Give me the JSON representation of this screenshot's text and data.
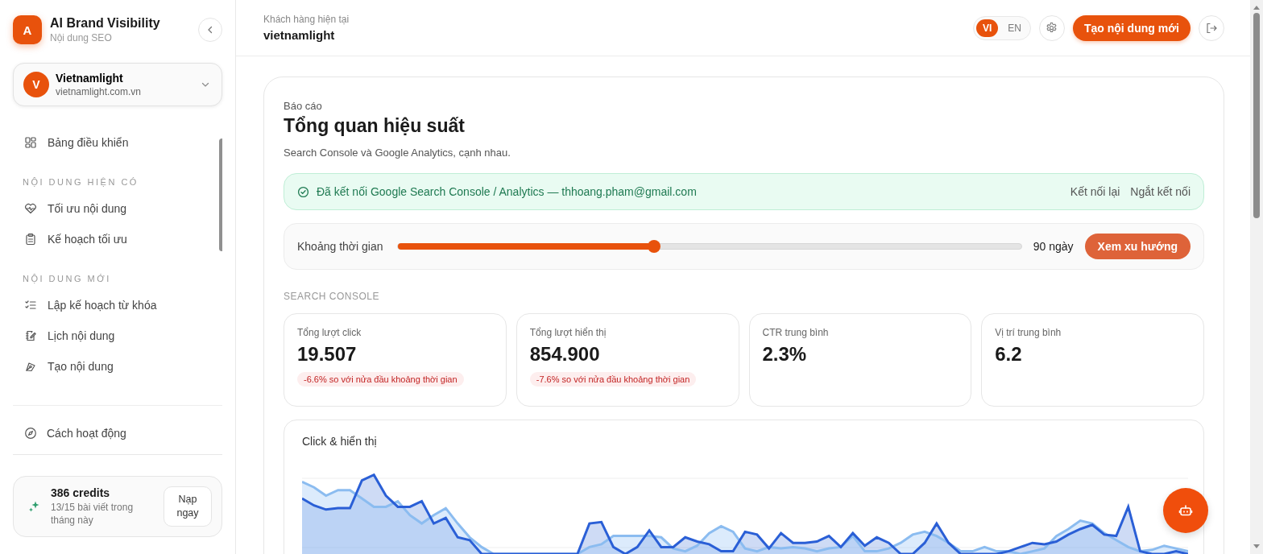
{
  "brand": {
    "logo_letter": "A",
    "title": "AI Brand Visibility",
    "subtitle": "Nội dung SEO"
  },
  "account": {
    "avatar_letter": "V",
    "name": "Vietnamlight",
    "domain": "vietnamlight.com.vn"
  },
  "nav": [
    {
      "kind": "link",
      "label": "Bảng điều khiển"
    },
    {
      "kind": "heading",
      "label": "NỘI DUNG HIỆN CÓ"
    },
    {
      "kind": "link",
      "label": "Tối ưu nội dung"
    },
    {
      "kind": "link",
      "label": "Kế hoạch tối ưu"
    },
    {
      "kind": "heading",
      "label": "NỘI DUNG MỚI"
    },
    {
      "kind": "link",
      "label": "Lập kế hoạch từ khóa"
    },
    {
      "kind": "link",
      "label": "Lịch nội dung"
    },
    {
      "kind": "link",
      "label": "Tạo nội dung"
    }
  ],
  "help_link": "Cách hoạt động",
  "credits": {
    "amount": "386 credits",
    "note": "13/15 bài viết trong tháng này",
    "button": "Nạp ngay"
  },
  "header": {
    "caption": "Khách hàng hiện tại",
    "client": "vietnamlight",
    "languages": [
      {
        "label": "VI",
        "selected": true
      },
      {
        "label": "EN",
        "selected": false
      }
    ],
    "primary_button": "Tạo nội dung mới"
  },
  "report": {
    "eyebrow": "Báo cáo",
    "title": "Tổng quan hiệu suất",
    "subtitle": "Search Console và Google Analytics, cạnh nhau.",
    "connection": {
      "message": "Đã kết nối Google Search Console / Analytics — thhoang.pham@gmail.com",
      "actions": [
        "Kết nối lại",
        "Ngắt kết nối"
      ]
    },
    "range": {
      "label": "Khoảng thời gian",
      "level": 0.41,
      "reading": "90 ngày",
      "button": "Xem xu hướng"
    },
    "section_title": "SEARCH CONSOLE",
    "metrics": [
      {
        "label": "Tổng lượt click",
        "value": "19.507",
        "change": "-6.6% so với nửa đầu khoảng thời gian"
      },
      {
        "label": "Tổng lượt hiển thị",
        "value": "854.900",
        "change": "-7.6% so với nửa đầu khoảng thời gian"
      },
      {
        "label": "CTR trung bình",
        "value": "2.3%"
      },
      {
        "label": "Vị trí trung bình",
        "value": "6.2"
      }
    ],
    "chart_title": "Click & hiển thị"
  }
}
